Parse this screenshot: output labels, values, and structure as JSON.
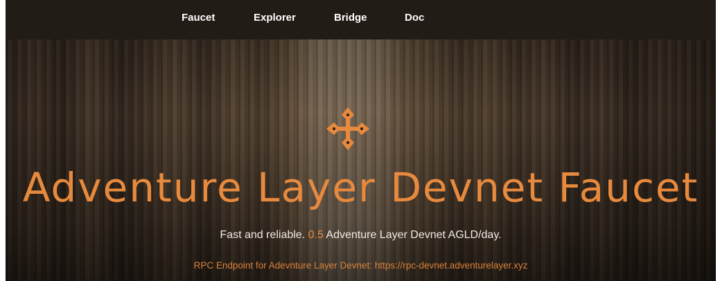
{
  "nav": {
    "items": [
      {
        "label": "Faucet"
      },
      {
        "label": "Explorer"
      },
      {
        "label": "Bridge"
      },
      {
        "label": "Doc"
      }
    ]
  },
  "hero": {
    "icon": "compass-star-icon",
    "title": "Adventure Layer Devnet Faucet",
    "tagline_prefix": "Fast and reliable. ",
    "tagline_amount": "0.5",
    "tagline_suffix": " Adventure Layer Devnet AGLD/day.",
    "rpc_text": "RPC Endpoint for Adevnture Layer Devnet: https://rpc-devnet.adventurelayer.xyz"
  },
  "colors": {
    "accent": "#e88a3e",
    "nav_bg": "#221c16",
    "text_light": "#f2ece4"
  }
}
